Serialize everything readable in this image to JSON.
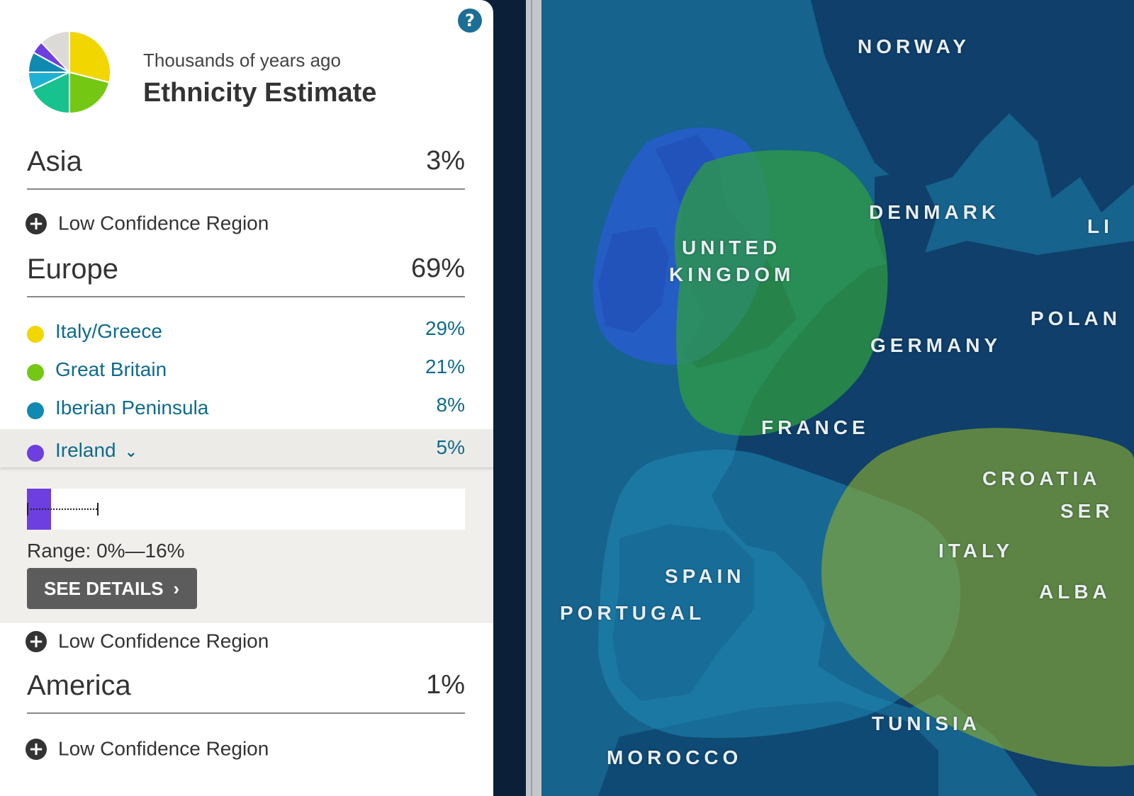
{
  "header": {
    "subtitle": "Thousands of years ago",
    "title": "Ethnicity Estimate",
    "help_glyph": "?"
  },
  "pie": {
    "slices": [
      {
        "label": "Italy/Greece",
        "value": 29,
        "color": "#f2d600"
      },
      {
        "label": "Great Britain",
        "value": 21,
        "color": "#74c814"
      },
      {
        "label": "Unlabeled teal",
        "value": 18,
        "color": "#18c28f"
      },
      {
        "label": "Unlabeled cyan",
        "value": 7,
        "color": "#1fb1d4"
      },
      {
        "label": "Iberian Peninsula",
        "value": 8,
        "color": "#0f8ab0"
      },
      {
        "label": "Ireland",
        "value": 5,
        "color": "#6d3ee0"
      },
      {
        "label": "Unlabeled grey",
        "value": 12,
        "color": "#dcdad6"
      }
    ]
  },
  "regions": {
    "asia": {
      "name": "Asia",
      "pct": "3%"
    },
    "europe": {
      "name": "Europe",
      "pct": "69%"
    },
    "america": {
      "name": "America",
      "pct": "1%"
    }
  },
  "low_confidence_label": "Low Confidence Region",
  "europe_items": [
    {
      "name": "Italy/Greece",
      "pct": "29%",
      "color": "#f2d600"
    },
    {
      "name": "Great Britain",
      "pct": "21%",
      "color": "#74c814"
    },
    {
      "name": "Iberian Peninsula",
      "pct": "8%",
      "color": "#0f8ab0"
    },
    {
      "name": "Ireland",
      "pct": "5%",
      "color": "#6d3ee0"
    }
  ],
  "ireland_detail": {
    "estimate_fraction": 0.05,
    "range_max_fraction": 0.16,
    "range_text": "Range: 0%—16%",
    "button_label": "SEE DETAILS",
    "button_arrow": "›"
  },
  "map": {
    "labels": {
      "norway": "NORWAY",
      "denmark": "DENMARK",
      "united": "UNITED",
      "kingdom": "KINGDOM",
      "germany": "GERMANY",
      "poland": "POLAN",
      "lithuania": "LI",
      "france": "FRANCE",
      "croatia": "CROATIA",
      "serbia": "SER",
      "italy": "ITALY",
      "albania": "ALBA",
      "spain": "SPAIN",
      "portugal": "PORTUGAL",
      "tunisia": "TUNISIA",
      "morocco": "MOROCCO"
    },
    "colors": {
      "sea": "#16638d",
      "land": "#0f3f6a",
      "ireland_region": "#2a5bd7",
      "britain_region": "#2fa040",
      "italy_region": "#8eae2e",
      "iberia_region": "#1f8ab5"
    }
  }
}
